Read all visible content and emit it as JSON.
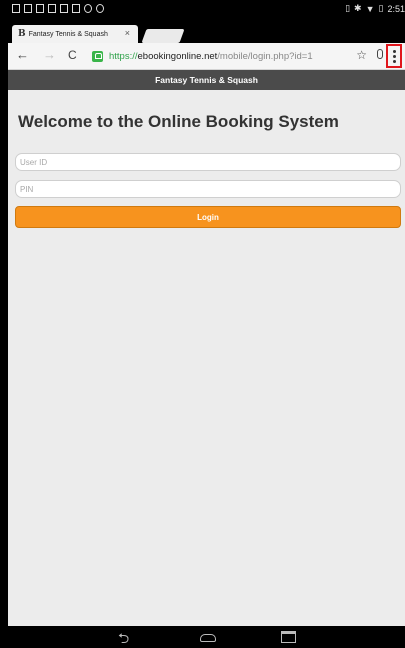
{
  "status_bar": {
    "time": "2:51"
  },
  "tab": {
    "favicon": "B",
    "title": "Fantasy Tennis & Squash",
    "close": "×"
  },
  "toolbar": {
    "back": "←",
    "forward": "→",
    "reload": "C",
    "url_scheme": "https://",
    "url_host": "ebookingonline.net",
    "url_path": "/mobile/login.php?id=1",
    "star": "☆"
  },
  "site_header": {
    "title": "Fantasy Tennis & Squash"
  },
  "main": {
    "heading": "Welcome to the Online Booking System",
    "user_id_placeholder": "User ID",
    "pin_placeholder": "PIN",
    "login_label": "Login"
  },
  "nav_bar": {
    "back": "⮌"
  },
  "colors": {
    "accent": "#f7931e",
    "header_bg": "#4b4b4b",
    "secure": "#3ab54a",
    "highlight": "#e0161c"
  }
}
